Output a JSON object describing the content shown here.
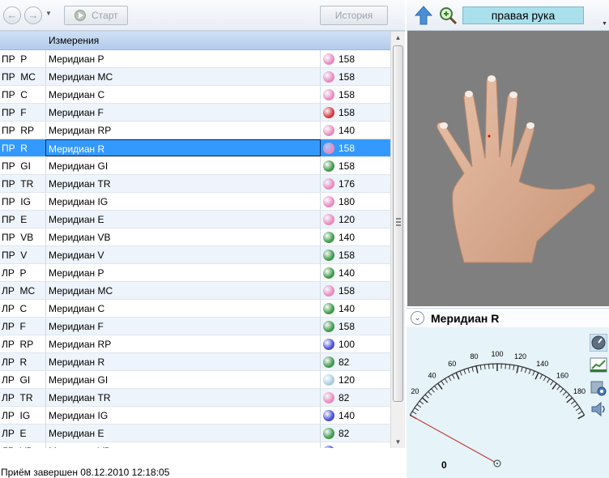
{
  "toolbar": {
    "back_glyph": "←",
    "forward_glyph": "→",
    "dropdown_glyph": "▼",
    "start_label": "Старт",
    "history_label": "История"
  },
  "table": {
    "header": "Измерения",
    "rows": [
      {
        "code": "ПР  P",
        "name": "Меридиан P",
        "value": "158",
        "dot": "#e88bbf"
      },
      {
        "code": "ПР  MC",
        "name": "Меридиан MC",
        "value": "158",
        "dot": "#e88bbf"
      },
      {
        "code": "ПР  C",
        "name": "Меридиан C",
        "value": "158",
        "dot": "#e88bbf"
      },
      {
        "code": "ПР  F",
        "name": "Меридиан F",
        "value": "158",
        "dot": "#d9383c"
      },
      {
        "code": "ПР  RP",
        "name": "Меридиан RP",
        "value": "140",
        "dot": "#e88bbf"
      },
      {
        "code": "ПР  R",
        "name": "Меридиан R",
        "value": "158",
        "dot": "#e88bbf",
        "selected": true
      },
      {
        "code": "ПР  GI",
        "name": "Меридиан GI",
        "value": "158",
        "dot": "#3f9a4a"
      },
      {
        "code": "ПР  TR",
        "name": "Меридиан TR",
        "value": "176",
        "dot": "#e88bbf"
      },
      {
        "code": "ПР  IG",
        "name": "Меридиан IG",
        "value": "180",
        "dot": "#e88bbf"
      },
      {
        "code": "ПР  E",
        "name": "Меридиан E",
        "value": "120",
        "dot": "#e88bbf"
      },
      {
        "code": "ПР  VB",
        "name": "Меридиан VB",
        "value": "140",
        "dot": "#3f9a4a"
      },
      {
        "code": "ПР  V",
        "name": "Меридиан V",
        "value": "158",
        "dot": "#3f9a4a"
      },
      {
        "code": "ЛР  P",
        "name": "Меридиан P",
        "value": "140",
        "dot": "#3f9a4a"
      },
      {
        "code": "ЛР  MC",
        "name": "Меридиан MC",
        "value": "158",
        "dot": "#e88bbf"
      },
      {
        "code": "ЛР  C",
        "name": "Меридиан C",
        "value": "140",
        "dot": "#3f9a4a"
      },
      {
        "code": "ЛР  F",
        "name": "Меридиан F",
        "value": "158",
        "dot": "#3f9a4a"
      },
      {
        "code": "ЛР  RP",
        "name": "Меридиан RP",
        "value": "100",
        "dot": "#4a4fd6"
      },
      {
        "code": "ЛР  R",
        "name": "Меридиан R",
        "value": "82",
        "dot": "#3f9a4a"
      },
      {
        "code": "ЛР  GI",
        "name": "Меридиан GI",
        "value": "120",
        "dot": "#a9cde0"
      },
      {
        "code": "ЛР  TR",
        "name": "Меридиан TR",
        "value": "82",
        "dot": "#e88bbf"
      },
      {
        "code": "ЛР  IG",
        "name": "Меридиан IG",
        "value": "140",
        "dot": "#4a4fd6"
      },
      {
        "code": "ЛР  E",
        "name": "Меридиан E",
        "value": "82",
        "dot": "#3f9a4a"
      },
      {
        "code": "ЛР  VB",
        "name": "Меридиан VB",
        "value": "",
        "dot": "#4a4fd6"
      }
    ]
  },
  "status": "Приём завершен 08.12.2010 12:18:05",
  "right_panel": {
    "hand_label": "правая рука",
    "meridian_title": "Меридиан R",
    "expand_glyph": "⌄",
    "gauge": {
      "min": 0,
      "max": 200,
      "tick_labels": [
        "0",
        "20",
        "40",
        "60",
        "80",
        "100",
        "120",
        "140",
        "160",
        "180",
        "200"
      ],
      "readout": "0",
      "needle_value": 0
    }
  },
  "icons": {
    "back": "back-arrow-icon",
    "forward": "forward-arrow-icon",
    "play": "play-icon",
    "up": "up-arrow-icon",
    "zoom": "zoom-icon",
    "gauge": "gauge-icon",
    "chart": "chart-icon",
    "settings": "settings-icon",
    "sound": "speaker-icon"
  }
}
